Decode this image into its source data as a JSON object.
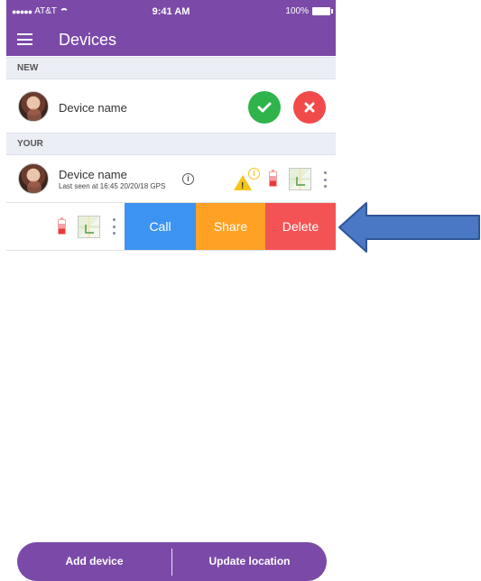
{
  "status_bar": {
    "signal": "●●●●●",
    "carrier": "AT&T",
    "time": "9:41 AM",
    "battery": "100%"
  },
  "header": {
    "title": "Devices"
  },
  "sections": {
    "new_label": "NEW",
    "your_label": "YOUR"
  },
  "new_device": {
    "name": "Device name"
  },
  "your_device": {
    "name": "Device name",
    "last_seen": "Last seen at 16:45 20/20/18 GPS",
    "info": "i",
    "warning_mark": "!",
    "warning_info": "i"
  },
  "swipe_actions": {
    "call": "Call",
    "share": "Share",
    "delete": "Delete"
  },
  "bottom_bar": {
    "add_device": "Add device",
    "update_location": "Update location"
  },
  "colors": {
    "primary": "#7b4aa8",
    "accept": "#2fb34b",
    "reject": "#f14a4a",
    "call": "#3d93f2",
    "share": "#ffa125",
    "delete": "#f45356",
    "arrow": "#4a78c4"
  }
}
